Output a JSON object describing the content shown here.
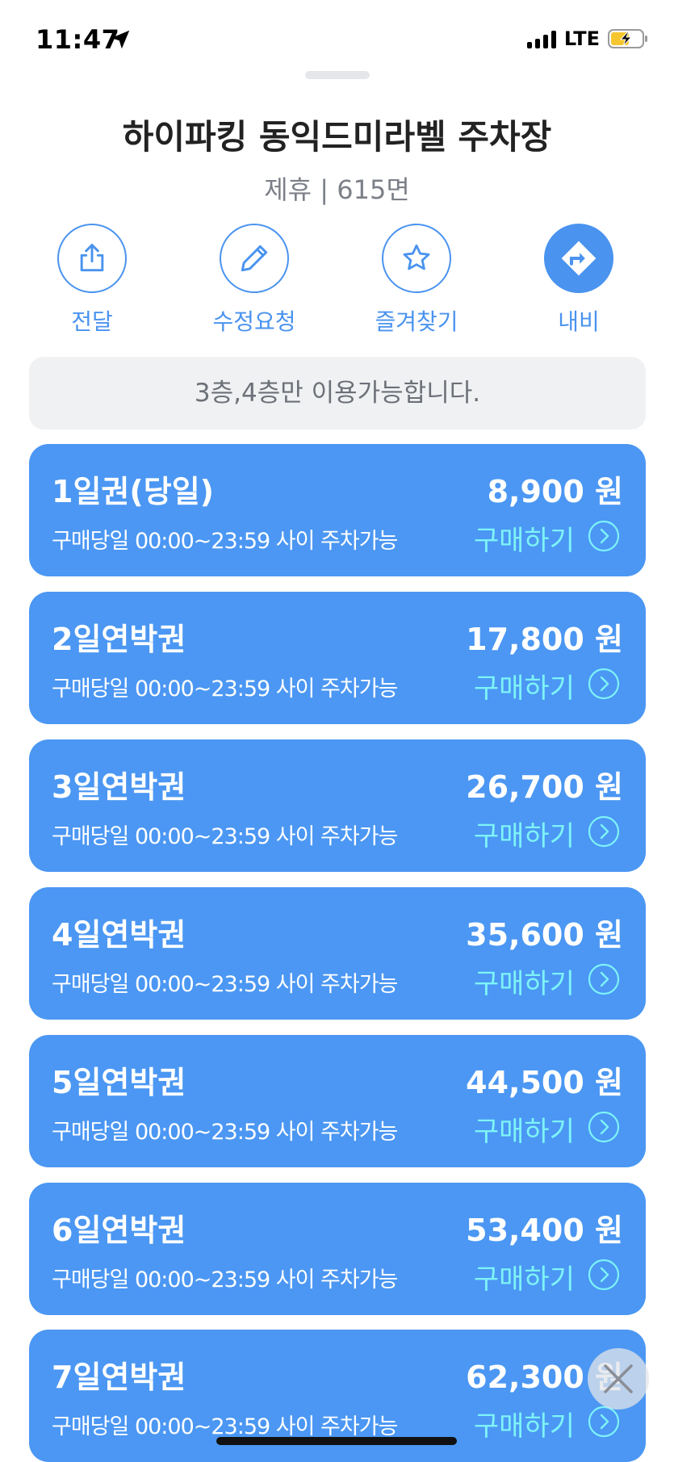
{
  "status_bar": {
    "time": "11:47",
    "network": "LTE"
  },
  "header": {
    "title": "하이파킹 동익드미라벨 주차장",
    "subtitle": "제휴 | 615면"
  },
  "actions": [
    {
      "label": "전달",
      "icon": "share-icon"
    },
    {
      "label": "수정요청",
      "icon": "pencil-icon"
    },
    {
      "label": "즐겨찾기",
      "icon": "star-icon"
    },
    {
      "label": "내비",
      "icon": "navigation-icon"
    }
  ],
  "notice": "3층,4층만 이용가능합니다.",
  "tickets": [
    {
      "name": "1일권(당일)",
      "price": "8,900 원",
      "desc": "구매당일 00:00~23:59 사이 주차가능",
      "buy": "구매하기"
    },
    {
      "name": "2일연박권",
      "price": "17,800 원",
      "desc": "구매당일 00:00~23:59 사이 주차가능",
      "buy": "구매하기"
    },
    {
      "name": "3일연박권",
      "price": "26,700 원",
      "desc": "구매당일 00:00~23:59 사이 주차가능",
      "buy": "구매하기"
    },
    {
      "name": "4일연박권",
      "price": "35,600 원",
      "desc": "구매당일 00:00~23:59 사이 주차가능",
      "buy": "구매하기"
    },
    {
      "name": "5일연박권",
      "price": "44,500 원",
      "desc": "구매당일 00:00~23:59 사이 주차가능",
      "buy": "구매하기"
    },
    {
      "name": "6일연박권",
      "price": "53,400 원",
      "desc": "구매당일 00:00~23:59 사이 주차가능",
      "buy": "구매하기"
    },
    {
      "name": "7일연박권",
      "price": "62,300 원",
      "desc": "구매당일 00:00~23:59 사이 주차가능",
      "buy": "구매하기"
    }
  ],
  "colors": {
    "accent": "#4a93ef",
    "card": "#4b97f3",
    "buy_text": "#7ef3f7",
    "notice_bg": "#f0f1f3"
  }
}
